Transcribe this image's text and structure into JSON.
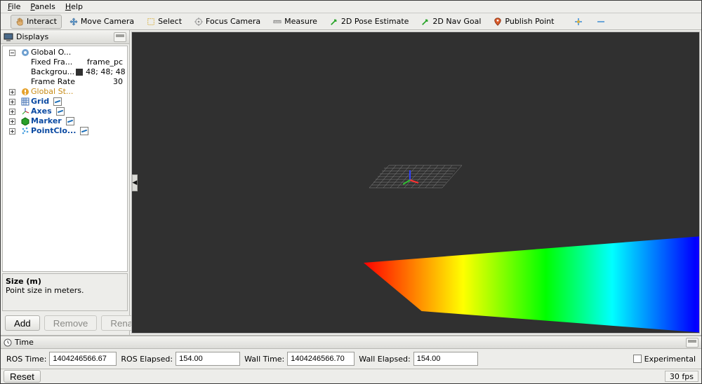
{
  "menu": {
    "items": [
      "File",
      "Panels",
      "Help"
    ]
  },
  "toolbar": {
    "interact": "Interact",
    "move_camera": "Move Camera",
    "select": "Select",
    "focus_camera": "Focus Camera",
    "measure": "Measure",
    "pose_estimate": "2D Pose Estimate",
    "nav_goal": "2D Nav Goal",
    "publish_point": "Publish Point"
  },
  "displays": {
    "title": "Displays",
    "icon": "displays-icon",
    "global_options": "Global O...",
    "props": [
      {
        "name": "Fixed Fra...",
        "value": "frame_pc"
      },
      {
        "name": "Backgrou...",
        "value": "48; 48; 48"
      },
      {
        "name": "Frame Rate",
        "value": "30"
      }
    ],
    "global_status": "Global St...",
    "items": [
      {
        "name": "Grid",
        "icon": "grid-icon",
        "checked": true
      },
      {
        "name": "Axes",
        "icon": "axes-icon",
        "checked": true
      },
      {
        "name": "Marker",
        "icon": "marker-icon",
        "checked": true
      },
      {
        "name": "PointClo...",
        "icon": "pointcloud-icon",
        "checked": true
      }
    ],
    "help": {
      "title": "Size (m)",
      "text": "Point size in meters."
    },
    "buttons": {
      "add": "Add",
      "remove": "Remove",
      "rename": "Rename"
    }
  },
  "time_panel": {
    "title": "Time",
    "ros_time_label": "ROS Time:",
    "ros_time": "1404246566.67",
    "ros_elapsed_label": "ROS Elapsed:",
    "ros_elapsed": "154.00",
    "wall_time_label": "Wall Time:",
    "wall_time": "1404246566.70",
    "wall_elapsed_label": "Wall Elapsed:",
    "wall_elapsed": "154.00",
    "experimental": "Experimental"
  },
  "status_bar": {
    "reset": "Reset",
    "fps": "30 fps"
  }
}
